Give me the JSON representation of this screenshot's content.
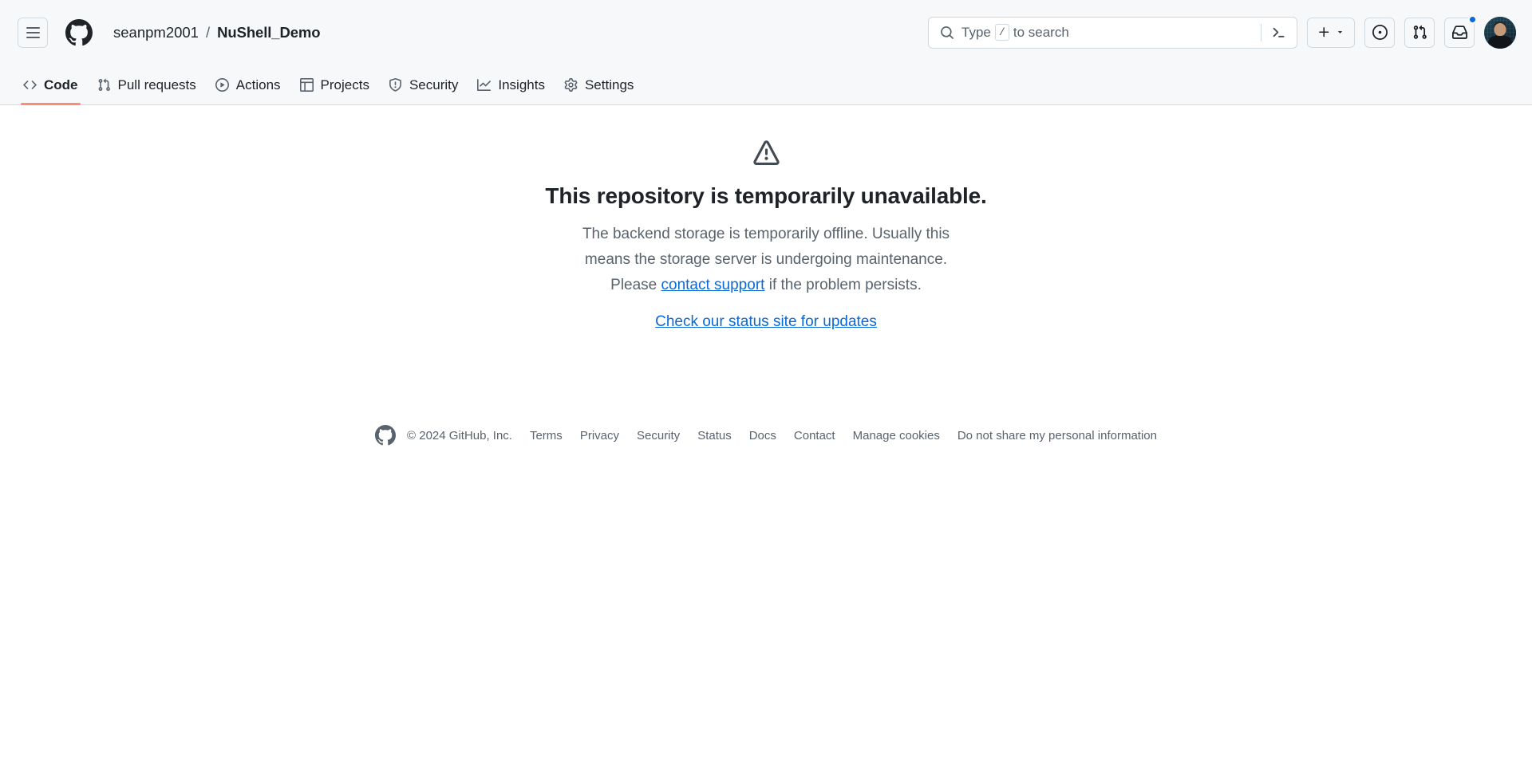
{
  "header": {
    "menu_icon": "hamburger-icon",
    "logo_icon": "github-mark-icon",
    "owner": "seanpm2001",
    "separator": "/",
    "repo": "NuShell_Demo",
    "search": {
      "icon": "search-icon",
      "placeholder_prefix": "Type",
      "key_hint": "/",
      "placeholder_suffix": "to search",
      "terminal_icon": "terminal-icon"
    },
    "actions": [
      {
        "name": "create-new-button",
        "icon": "plus-icon",
        "caret": "triangle-down-icon"
      },
      {
        "name": "issues-button",
        "icon": "issue-opened-icon"
      },
      {
        "name": "pull-requests-button",
        "icon": "git-pull-request-icon"
      },
      {
        "name": "notifications-button",
        "icon": "inbox-icon",
        "has_unread_dot": true
      }
    ],
    "avatar": {
      "name": "avatar",
      "alt": "seanpm2001"
    },
    "accent_unread": "#0969da"
  },
  "repo_nav": {
    "active": "Code",
    "underline_color": "#fd8c73",
    "tabs": [
      {
        "label": "Code",
        "icon": "code-icon"
      },
      {
        "label": "Pull requests",
        "icon": "git-pull-request-icon"
      },
      {
        "label": "Actions",
        "icon": "play-icon"
      },
      {
        "label": "Projects",
        "icon": "table-icon"
      },
      {
        "label": "Security",
        "icon": "shield-icon"
      },
      {
        "label": "Insights",
        "icon": "graph-icon"
      },
      {
        "label": "Settings",
        "icon": "gear-icon"
      }
    ]
  },
  "main": {
    "warning_icon": "alert-triangle-icon",
    "title": "This repository is temporarily unavailable.",
    "description_line1": "The backend storage is temporarily offline. Usually this",
    "description_line2": "means the storage server is undergoing maintenance.",
    "description_line3_before": "Please ",
    "support_link": "contact support",
    "description_line3_after": " if the problem persists.",
    "status_link": "Check our status site for updates",
    "link_color": "#0969da"
  },
  "footer": {
    "logo_icon": "github-mark-icon",
    "copyright": "© 2024 GitHub, Inc.",
    "links": [
      "Terms",
      "Privacy",
      "Security",
      "Status",
      "Docs",
      "Contact",
      "Manage cookies",
      "Do not share my personal information"
    ]
  }
}
